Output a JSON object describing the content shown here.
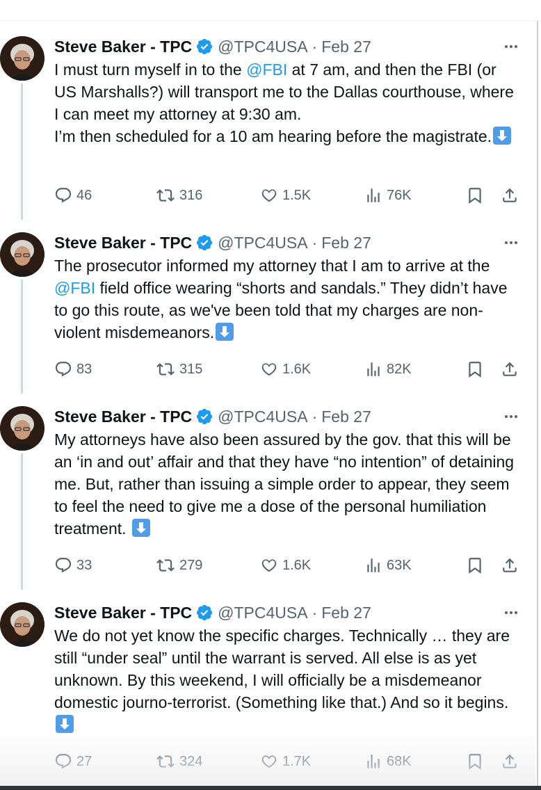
{
  "tweets": [
    {
      "author": {
        "name": "Steve Baker - TPC",
        "handle": "@TPC4USA",
        "date": "Feb 27"
      },
      "text_segments": [
        {
          "t": "I must turn myself in to the ",
          "mention": false
        },
        {
          "t": "@FBI",
          "mention": true
        },
        {
          "t": " at 7 am, and then the FBI (or US Marshalls?) will transport me to the Dallas courthouse, where I can meet my attorney at 9:30 am.",
          "mention": false
        }
      ],
      "text_line2": "I’m then scheduled for a 10 am hearing before the magistrate.",
      "stats": {
        "replies": "46",
        "reposts": "316",
        "likes": "1.5K",
        "views": "76K"
      }
    },
    {
      "author": {
        "name": "Steve Baker - TPC",
        "handle": "@TPC4USA",
        "date": "Feb 27"
      },
      "text_before": "The prosecutor informed my attorney that I am to arrive at the ",
      "mention": "@FBI",
      "text_after": " field office wearing “shorts and sandals.” They didn’t have to go this route, as we've been told that my charges are non-violent misdemeanors.",
      "stats": {
        "replies": "83",
        "reposts": "315",
        "likes": "1.6K",
        "views": "82K"
      }
    },
    {
      "author": {
        "name": "Steve Baker - TPC",
        "handle": "@TPC4USA",
        "date": "Feb 27"
      },
      "text": "My attorneys have also been assured by the gov. that this will be an ‘in and out’ affair and that they have “no intention” of detaining me. But, rather than issuing a simple order to appear, they seem to feel the need to give me a dose of the personal humiliation treatment. ",
      "stats": {
        "replies": "33",
        "reposts": "279",
        "likes": "1.6K",
        "views": "63K"
      }
    },
    {
      "author": {
        "name": "Steve Baker - TPC",
        "handle": "@TPC4USA",
        "date": "Feb 27"
      },
      "text": "We do not yet know the specific charges. Technically … they are still “under seal” until the warrant is served. All else is as yet unknown. By this weekend, I will officially be a misdemeanor domestic journo-terrorist. (Something like that.) And so it begins.",
      "stats": {
        "replies": "27",
        "reposts": "324",
        "likes": "1.7K",
        "views": "68K"
      }
    }
  ],
  "colors": {
    "accent": "#1d9bf0",
    "muted": "#536471",
    "text": "#0f1419",
    "emoji": "#4f9de8"
  },
  "icons": [
    "verified-badge-icon",
    "more-icon",
    "reply-icon",
    "repost-icon",
    "like-icon",
    "views-icon",
    "bookmark-icon",
    "share-icon",
    "down-arrow-emoji"
  ]
}
